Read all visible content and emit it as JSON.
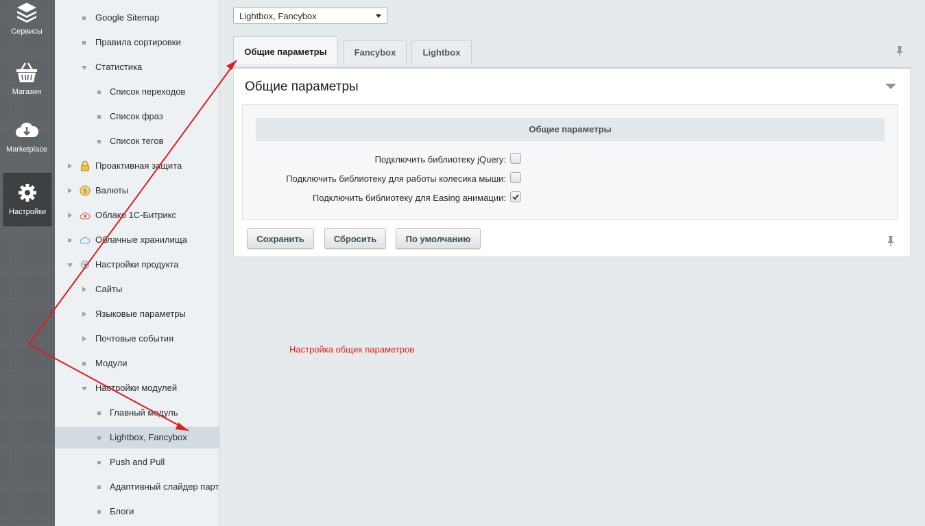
{
  "iconbar": {
    "items": [
      {
        "label": "Сервисы",
        "icon": "layers-icon"
      },
      {
        "label": "Магазин",
        "icon": "basket-icon"
      },
      {
        "label": "Marketplace",
        "icon": "cloud-download-icon"
      },
      {
        "label": "Настройки",
        "icon": "gear-icon",
        "active": true
      }
    ]
  },
  "tree": {
    "items": [
      {
        "label": "Google Sitemap"
      },
      {
        "label": "Правила сортировки"
      },
      {
        "label": "Статистика"
      },
      {
        "label": "Список переходов"
      },
      {
        "label": "Список фраз"
      },
      {
        "label": "Список тегов"
      },
      {
        "label": "Проактивная защита"
      },
      {
        "label": "Валюты"
      },
      {
        "label": "Облако 1С-Битрикс"
      },
      {
        "label": "Облачные хранилища"
      },
      {
        "label": "Настройки продукта"
      },
      {
        "label": "Сайты"
      },
      {
        "label": "Языковые параметры"
      },
      {
        "label": "Почтовые события"
      },
      {
        "label": "Модули"
      },
      {
        "label": "Настройки модулей"
      },
      {
        "label": "Главный модуль"
      },
      {
        "label": "Lightbox, Fancybox",
        "selected": true
      },
      {
        "label": "Push and Pull"
      },
      {
        "label": "Адаптивный слайдер партнеров"
      },
      {
        "label": "Блоги"
      }
    ]
  },
  "main": {
    "site_select": "Lightbox, Fancybox",
    "tabs": [
      {
        "label": "Общие параметры",
        "active": true
      },
      {
        "label": "Fancybox"
      },
      {
        "label": "Lightbox"
      }
    ],
    "panel_title": "Общие параметры",
    "section_header": "Общие параметры",
    "fields": [
      {
        "label": "Подключить библиотеку jQuery:",
        "checked": false
      },
      {
        "label": "Подключить библиотеку для работы колесика мыши:",
        "checked": false
      },
      {
        "label": "Подключить библиотеку для Easing анимации:",
        "checked": true
      }
    ],
    "buttons": {
      "save": "Сохранить",
      "reset": "Сбросить",
      "default": "По умолчанию"
    }
  },
  "annotation": "Настройка общих параметров",
  "colors": {
    "annotation": "#e41b1b",
    "sidebar": "#5d6266"
  }
}
